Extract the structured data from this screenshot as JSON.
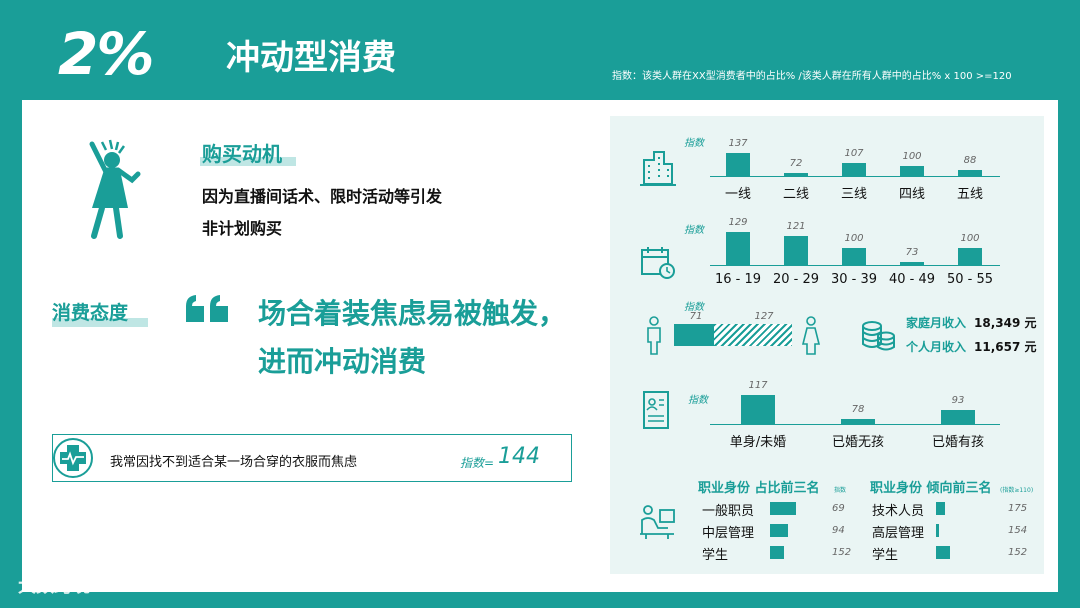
{
  "header": {
    "percent": "2%",
    "title": "冲动型消费",
    "note": "指数：该类人群在XX型消费者中的占比% /该类人群在所有人群中的占比% x 100 >=120"
  },
  "motive": {
    "label": "购买动机",
    "line1": "因为直播间话术、限时活动等引发",
    "line2": "非计划购买"
  },
  "attitude": {
    "label": "消费态度",
    "quote_mark": "❝",
    "line1": "场合着装焦虑易被触发，",
    "line2": "进而冲动消费"
  },
  "statement": {
    "text": "我常因找不到适合某一场合穿的衣服而焦虑",
    "index_label": "指数=",
    "index_value": "144"
  },
  "panel": {
    "index_word": "指数",
    "city": {
      "categories": [
        "一线",
        "二线",
        "三线",
        "四线",
        "五线"
      ],
      "values": [
        137,
        72,
        107,
        100,
        88
      ],
      "value_labels": [
        "137",
        "72",
        "107",
        "100",
        "88"
      ]
    },
    "age": {
      "categories": [
        "16 - 19",
        "20 - 29",
        "30 - 39",
        "40 - 49",
        "50 - 55"
      ],
      "values": [
        129,
        121,
        100,
        73,
        100
      ],
      "value_labels": [
        "129",
        "121",
        "100",
        "73",
        "100"
      ]
    },
    "gender": {
      "male_value": "71",
      "female_value": "127"
    },
    "income": {
      "family_label": "家庭月收入",
      "family_value": "18,349 元",
      "personal_label": "个人月收入",
      "personal_value": "11,657 元"
    },
    "marital": {
      "categories": [
        "单身/未婚",
        "已婚无孩",
        "已婚有孩"
      ],
      "values": [
        117,
        78,
        93
      ],
      "value_labels": [
        "117",
        "78",
        "93"
      ]
    },
    "job_share": {
      "title": "职业身份 占比前三名",
      "idx_note": "指数",
      "items": [
        "一般职员",
        "中层管理",
        "学生"
      ],
      "index_labels": [
        "69",
        "94",
        "152"
      ],
      "shares": [
        1.0,
        0.7,
        0.55
      ]
    },
    "job_tendency": {
      "title": "职业身份 倾向前三名",
      "idx_note": "(指数≥110)",
      "items": [
        "技术人员",
        "高层管理",
        "学生"
      ],
      "index_labels": [
        "175",
        "154",
        "152"
      ],
      "shares": [
        0.55,
        0.2,
        0.85
      ]
    }
  },
  "watermark": "大数跨境",
  "colors": {
    "accent": "#1a9e98",
    "light": "#bfe6e4",
    "panel": "#eaf5f4"
  }
}
